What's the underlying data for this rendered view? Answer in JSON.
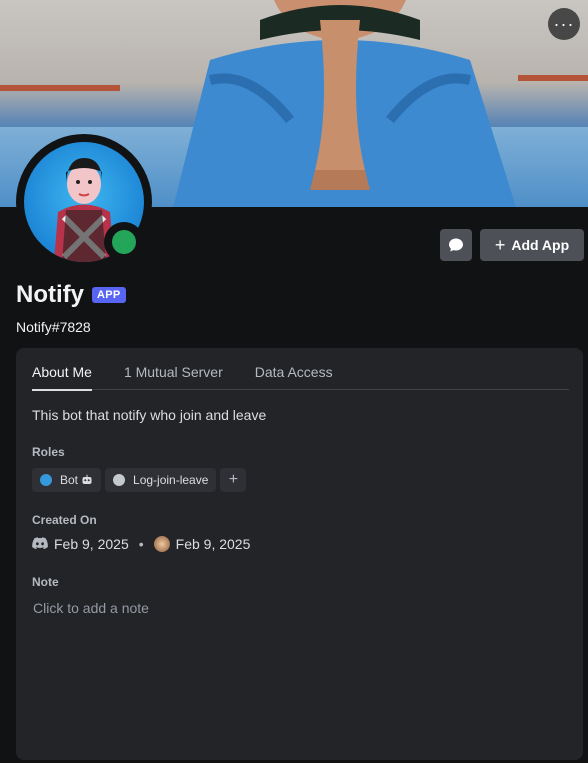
{
  "header": {
    "more_label": "···"
  },
  "profile": {
    "display_name": "Notify",
    "tag": "APP",
    "username": "Notify#7828",
    "status": "online",
    "status_color": "#23a55a"
  },
  "actions": {
    "message_icon": "message-bubble-icon",
    "add_app_label": "Add App"
  },
  "tabs": [
    {
      "label": "About Me",
      "active": true
    },
    {
      "label": "1 Mutual Server",
      "active": false
    },
    {
      "label": "Data Access",
      "active": false
    }
  ],
  "about": {
    "text": "This bot that notify who join and leave"
  },
  "roles": {
    "title": "Roles",
    "items": [
      {
        "label": "Bot",
        "color": "#3498db"
      },
      {
        "label": "Log-join-leave",
        "color": "#c4c9ce"
      }
    ],
    "add_label": "+"
  },
  "created": {
    "title": "Created On",
    "discord_date": "Feb 9, 2025",
    "server_date": "Feb 9, 2025"
  },
  "note": {
    "title": "Note",
    "placeholder": "Click to add a note"
  },
  "colors": {
    "accent": "#5865f2",
    "background": "#111214",
    "card": "#232428"
  }
}
